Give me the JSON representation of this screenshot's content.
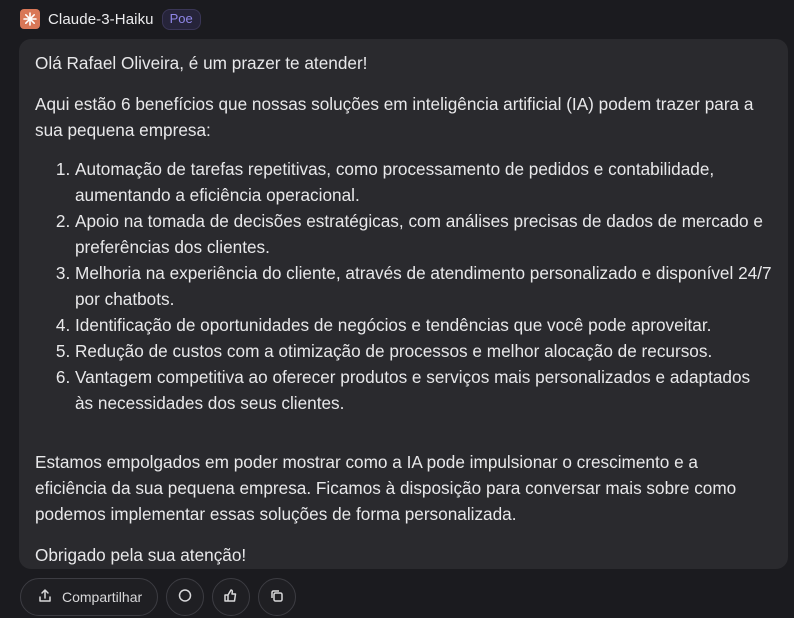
{
  "header": {
    "bot_name": "Claude-3-Haiku",
    "badge": "Poe",
    "avatar_icon": "claude-sparkle-icon",
    "avatar_color": "#d97757"
  },
  "message": {
    "greeting": "Olá Rafael Oliveira, é um prazer te atender!",
    "intro": "Aqui estão 6 benefícios que nossas soluções em inteligência artificial (IA) podem trazer para a sua pequena empresa:",
    "benefits": [
      "Automação de tarefas repetitivas, como processamento de pedidos e contabilidade, aumentando a eficiência operacional.",
      "Apoio na tomada de decisões estratégicas, com análises precisas de dados de mercado e preferências dos clientes.",
      "Melhoria na experiência do cliente, através de atendimento personalizado e disponível 24/7 por chatbots.",
      "Identificação de oportunidades de negócios e tendências que você pode aproveitar.",
      "Redução de custos com a otimização de processos e melhor alocação de recursos.",
      "Vantagem competitiva ao oferecer produtos e serviços mais personalizados e adaptados às necessidades dos seus clientes."
    ],
    "closing": "Estamos empolgados em poder mostrar como a IA pode impulsionar o crescimento e a eficiência da sua pequena empresa. Ficamos à disposição para conversar mais sobre como podemos implementar essas soluções de forma personalizada.",
    "signoff": "Obrigado pela sua atenção!"
  },
  "actions": {
    "share_label": "Compartilhar",
    "icons": [
      "share-icon",
      "chat-bubble-icon",
      "thumbs-up-icon",
      "copy-icon"
    ]
  }
}
